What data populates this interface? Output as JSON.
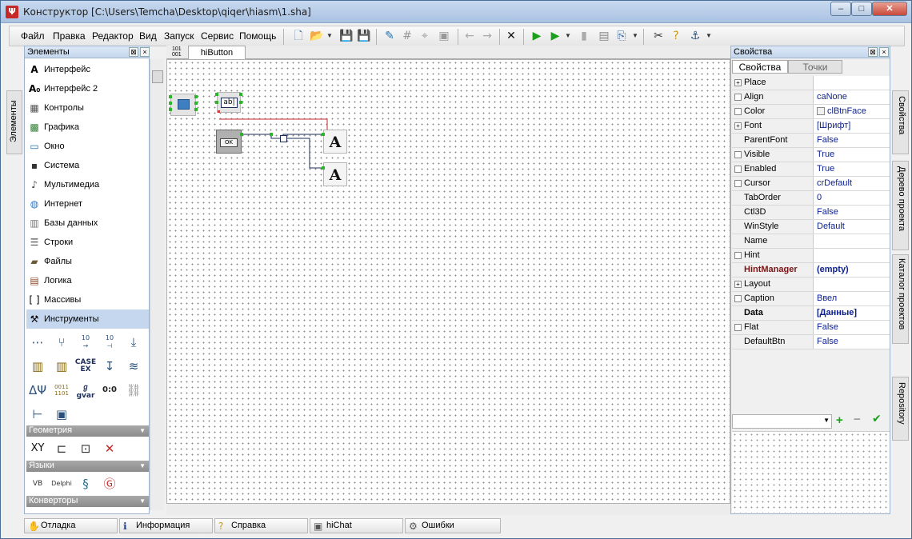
{
  "window": {
    "title": "Конструктор [C:\\Users\\Temcha\\Desktop\\qiqer\\hiasm\\1.sha]"
  },
  "menu": [
    "Файл",
    "Правка",
    "Редактор",
    "Вид",
    "Запуск",
    "Сервис",
    "Помощь"
  ],
  "side_tabs": {
    "left": "Элементы",
    "right": [
      "Свойства",
      "Дерево проекта",
      "Каталог проектов",
      "Repository"
    ]
  },
  "elements_panel": {
    "title": "Элементы",
    "items": [
      {
        "label": "Интерфейс",
        "icon": "letter-a-icon"
      },
      {
        "label": "Интерфейс 2",
        "icon": "letter-a0-icon"
      },
      {
        "label": "Контролы",
        "icon": "controls-icon"
      },
      {
        "label": "Графика",
        "icon": "graphics-icon"
      },
      {
        "label": "Окно",
        "icon": "window-icon"
      },
      {
        "label": "Система",
        "icon": "system-icon"
      },
      {
        "label": "Мультимедиа",
        "icon": "music-note-icon"
      },
      {
        "label": "Интернет",
        "icon": "globe-icon"
      },
      {
        "label": "Базы данных",
        "icon": "database-icon"
      },
      {
        "label": "Строки",
        "icon": "lines-icon"
      },
      {
        "label": "Файлы",
        "icon": "folder-icon"
      },
      {
        "label": "Логика",
        "icon": "calculator-icon"
      },
      {
        "label": "Массивы",
        "icon": "brackets-icon"
      },
      {
        "label": "Инструменты",
        "icon": "tools-icon"
      }
    ],
    "tool_labels": {
      "case": "CASE",
      "case_sub": "EX",
      "gvar": "gvar",
      "bits": "0011\n1101",
      "zero_zero": "0:0",
      "num10": "10",
      "delphi": "Delphi",
      "vb": "VB",
      "xy": "XY",
      "xy_small": "xy"
    },
    "groups": [
      "Геометрия",
      "Языки",
      "Конверторы"
    ]
  },
  "document_tab": {
    "label": "hiButton",
    "icon_text": "101\n001"
  },
  "canvas_components": [
    {
      "name": "form",
      "caption": ""
    },
    {
      "name": "edit",
      "caption": "ab|"
    },
    {
      "name": "button",
      "caption": "OK"
    },
    {
      "name": "message-a-1",
      "caption": "A"
    },
    {
      "name": "message-a-2",
      "caption": "A"
    }
  ],
  "properties_panel": {
    "title": "Свойства",
    "tabs": [
      "Свойства",
      "Точки"
    ],
    "rows": [
      {
        "name": "Place",
        "value": "",
        "expand": "+"
      },
      {
        "name": "Align",
        "value": "caNone",
        "check": true
      },
      {
        "name": "Color",
        "value": "clBtnFace",
        "check": true,
        "swatch": "#f0f0f0"
      },
      {
        "name": "Font",
        "value": "[Шрифт]",
        "expand": "+"
      },
      {
        "name": "ParentFont",
        "value": "False"
      },
      {
        "name": "Visible",
        "value": "True",
        "check": true
      },
      {
        "name": "Enabled",
        "value": "True",
        "check": true
      },
      {
        "name": "Cursor",
        "value": "crDefault",
        "check": true
      },
      {
        "name": "TabOrder",
        "value": "0"
      },
      {
        "name": "Ctl3D",
        "value": "False"
      },
      {
        "name": "WinStyle",
        "value": "Default"
      },
      {
        "name": "Name",
        "value": ""
      },
      {
        "name": "Hint",
        "value": "",
        "check": true
      },
      {
        "name": "HintManager",
        "value": "(empty)",
        "style": "bold"
      },
      {
        "name": "Layout",
        "value": "",
        "expand": "+"
      },
      {
        "name": "Caption",
        "value": "Ввел",
        "check": true
      },
      {
        "name": "Data",
        "value": "[Данные]",
        "style": "boldblk"
      },
      {
        "name": "Flat",
        "value": "False",
        "check": true
      },
      {
        "name": "DefaultBtn",
        "value": "False"
      }
    ]
  },
  "bottom_tabs": [
    {
      "label": "Отладка",
      "icon": "hand-icon"
    },
    {
      "label": "Информация",
      "icon": "info-icon"
    },
    {
      "label": "Справка",
      "icon": "help-icon"
    },
    {
      "label": "hiChat",
      "icon": "chat-icon"
    },
    {
      "label": "Ошибки",
      "icon": "errors-icon"
    }
  ],
  "colors": {
    "accent": "#c5d7ee",
    "selection_dot": "#2bb52b",
    "link_red": "#c62828",
    "link_dark": "#1c2c5a"
  }
}
